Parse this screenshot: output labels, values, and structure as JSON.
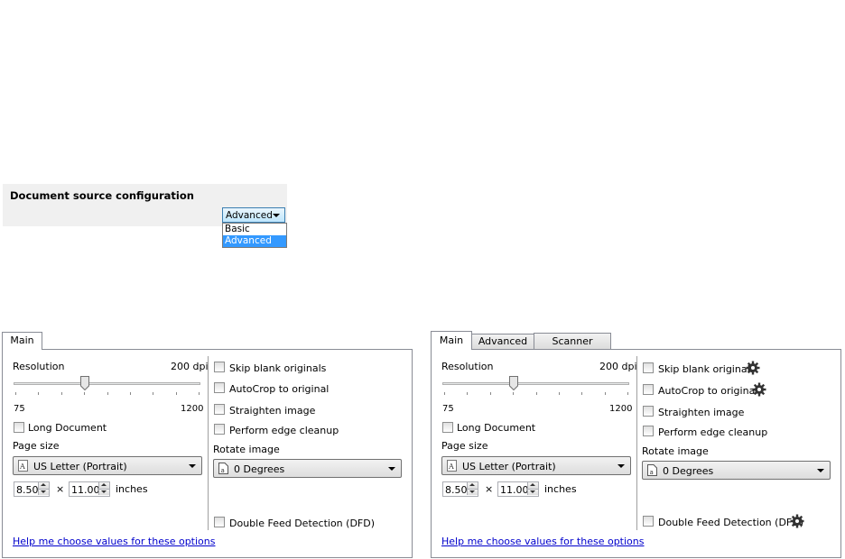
{
  "source_config": {
    "title": "Document source configuration",
    "selected": "Advanced",
    "options": [
      "Basic",
      "Advanced"
    ]
  },
  "left_panel": {
    "tabs": [
      "Main"
    ],
    "resolution_label": "Resolution",
    "resolution_value": "200 dpi",
    "resolution_level": 200,
    "slider_min": "75",
    "slider_max": "1200",
    "long_document": "Long Document",
    "page_size_label": "Page size",
    "page_size_value": "US Letter (Portrait)",
    "width_value": "8.50",
    "times": "×",
    "height_value": "11.00",
    "units": "inches",
    "skip_blank": "Skip blank originals",
    "autocrop": "AutoCrop to original",
    "straighten": "Straighten image",
    "edge_cleanup": "Perform edge cleanup",
    "rotate_label": "Rotate image",
    "rotate_value": "0 Degrees",
    "dfd": "Double Feed Detection (DFD)",
    "help_link": "Help me choose values for these options"
  },
  "right_panel": {
    "tabs": [
      "Main",
      "Advanced",
      "Scanner"
    ],
    "resolution_label": "Resolution",
    "resolution_value": "200 dpi",
    "resolution_level": 200,
    "slider_min": "75",
    "slider_max": "1200",
    "long_document": "Long Document",
    "page_size_label": "Page size",
    "page_size_value": "US Letter (Portrait)",
    "width_value": "8.50",
    "times": "×",
    "height_value": "11.00",
    "units": "inches",
    "skip_blank": "Skip blank originals",
    "autocrop": "AutoCrop to original",
    "straighten": "Straighten image",
    "edge_cleanup": "Perform edge cleanup",
    "rotate_label": "Rotate image",
    "rotate_value": "0 Degrees",
    "dfd": "Double Feed Detection (DFD)",
    "help_link": "Help me choose values for these options"
  }
}
